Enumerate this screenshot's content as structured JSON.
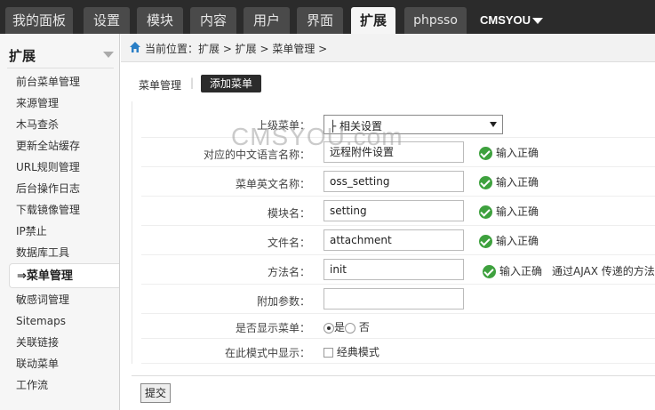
{
  "nav": {
    "tabs": [
      "我的面板",
      "设置",
      "模块",
      "内容",
      "用户",
      "界面",
      "扩展",
      "phpsso"
    ],
    "active_index": 6,
    "brand": "CMSYOU"
  },
  "sidebar": {
    "title": "扩展",
    "items": [
      "前台菜单管理",
      "来源管理",
      "木马查杀",
      "更新全站缓存",
      "URL规则管理",
      "后台操作日志",
      "下载镜像管理",
      "IP禁止",
      "数据库工具",
      "菜单管理",
      "敏感词管理",
      "Sitemaps",
      "关联链接",
      "联动菜单",
      "工作流"
    ],
    "active_index": 9,
    "active_prefix": "⇒"
  },
  "breadcrumb": {
    "text": "当前位置：扩展 > 扩展 > 菜单管理 >"
  },
  "subtabs": {
    "manage": "菜单管理",
    "add": "添加菜单",
    "separator": "|"
  },
  "form": {
    "parent_label": "上级菜单：",
    "parent_value": "├ 相关设置",
    "cn_name_label": "对应的中文语言名称：",
    "cn_name_value": "远程附件设置",
    "en_name_label": "菜单英文名称：",
    "en_name_value": "oss_setting",
    "module_label": "模块名：",
    "module_value": "setting",
    "file_label": "文件名：",
    "file_value": "attachment",
    "method_label": "方法名：",
    "method_value": "init",
    "method_hint": "通过AJAX 传递的方法",
    "extra_label": "附加参数：",
    "extra_value": "",
    "display_label": "是否显示菜单：",
    "display_yes": "是",
    "display_no": "否",
    "display_selected": "yes",
    "mode_label": "在此模式中显示：",
    "mode_option": "经典模式",
    "ok_text": "输入正确"
  },
  "watermark": "CMSYOU.com",
  "submit_label": "提交",
  "colors": {
    "topbar": "#2b2b2b",
    "ok_green": "#3ea13e",
    "home_blue": "#2a7fc6"
  }
}
